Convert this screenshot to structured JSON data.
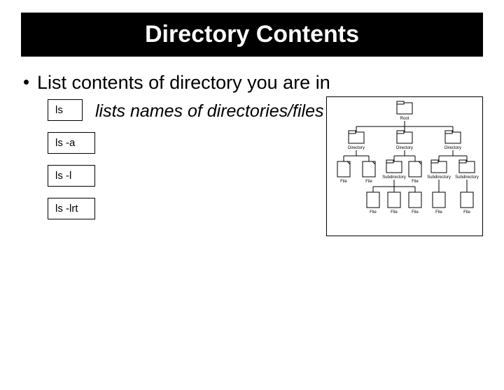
{
  "title": "Directory Contents",
  "bullet": "List contents of directory you are in",
  "commands": {
    "c1": "ls",
    "c2": "ls  -a",
    "c3": "ls  -l",
    "c4": "ls  -lrt"
  },
  "description": "lists names of directories/files",
  "diagram": {
    "root": "Root",
    "dir": "Directory",
    "file": "File",
    "sub": "Subdirectory"
  }
}
